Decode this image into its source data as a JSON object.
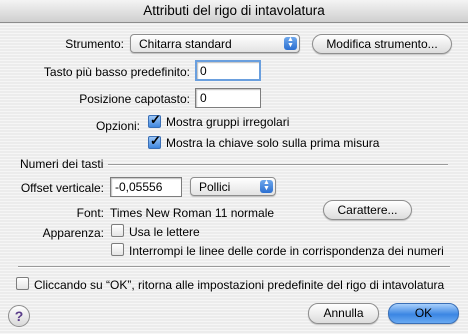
{
  "window": {
    "title": "Attributi del rigo di intavolatura"
  },
  "strumento": {
    "label": "Strumento:",
    "value": "Chitarra standard",
    "modify_button": "Modifica strumento..."
  },
  "tasto_basso": {
    "label": "Tasto più basso predefinito:",
    "value": "0"
  },
  "capotasto": {
    "label": "Posizione capotasto:",
    "value": "0"
  },
  "opzioni": {
    "label": "Opzioni:",
    "gruppi": {
      "label": "Mostra gruppi irregolari",
      "checked": true
    },
    "chiave": {
      "label": "Mostra la chiave solo sulla prima misura",
      "checked": true
    }
  },
  "numeri": {
    "section_title": "Numeri dei tasti",
    "offset": {
      "label": "Offset verticale:",
      "value": "-0,05556",
      "unit": "Pollici"
    },
    "font": {
      "label": "Font:",
      "value": "Times New Roman 11 normale",
      "button": "Carattere..."
    },
    "apparenza": {
      "label": "Apparenza:",
      "lettere": {
        "label": "Usa le lettere",
        "checked": false
      },
      "interrompi": {
        "label": "Interrompi le linee delle corde in corrispondenza dei numeri",
        "checked": false
      }
    }
  },
  "reset": {
    "label": "Cliccando su “OK”, ritorna alle impostazioni predefinite del rigo di intavolatura",
    "checked": false
  },
  "footer": {
    "help": "?",
    "cancel": "Annulla",
    "ok": "OK"
  },
  "colors": {
    "accent": "#3b86e3",
    "focus": "#6a9fde"
  }
}
